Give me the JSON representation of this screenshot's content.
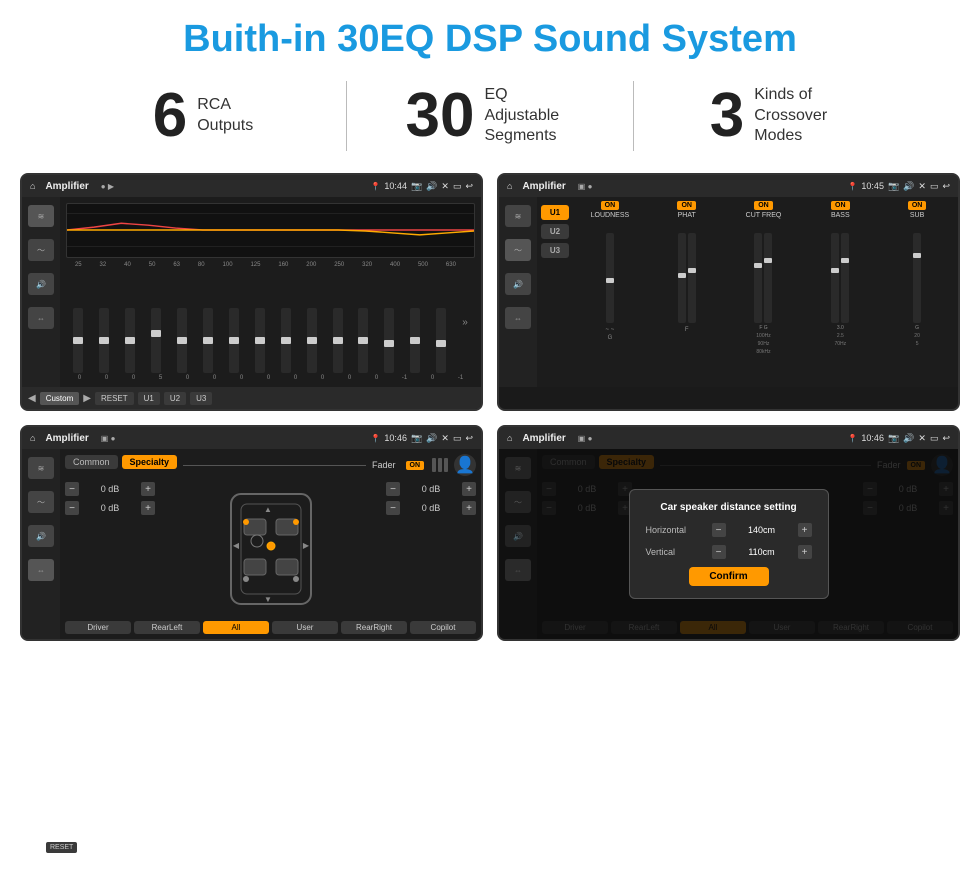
{
  "page": {
    "title": "Buith-in 30EQ DSP Sound System",
    "stats": [
      {
        "number": "6",
        "label": "RCA\nOutputs"
      },
      {
        "number": "30",
        "label": "EQ Adjustable\nSegments"
      },
      {
        "number": "3",
        "label": "Kinds of\nCrossover Modes"
      }
    ]
  },
  "screen1": {
    "status": {
      "title": "Amplifier",
      "time": "10:44"
    },
    "freqs": [
      "25",
      "32",
      "40",
      "50",
      "63",
      "80",
      "100",
      "125",
      "160",
      "200",
      "250",
      "320",
      "400",
      "500",
      "630"
    ],
    "values": [
      "0",
      "0",
      "0",
      "5",
      "0",
      "0",
      "0",
      "0",
      "0",
      "0",
      "0",
      "0",
      "-1",
      "0",
      "-1"
    ],
    "buttons": [
      "Custom",
      "RESET",
      "U1",
      "U2",
      "U3"
    ],
    "slider_positions": [
      50,
      50,
      50,
      38,
      50,
      50,
      50,
      50,
      50,
      50,
      50,
      50,
      54,
      50,
      54
    ]
  },
  "screen2": {
    "status": {
      "title": "Amplifier",
      "time": "10:45"
    },
    "presets": [
      "U1",
      "U2",
      "U3"
    ],
    "channels": [
      {
        "on": true,
        "label": "LOUDNESS"
      },
      {
        "on": true,
        "label": "PHAT"
      },
      {
        "on": true,
        "label": "CUT FREQ"
      },
      {
        "on": true,
        "label": "BASS"
      },
      {
        "on": true,
        "label": "SUB"
      }
    ],
    "reset_label": "RESET"
  },
  "screen3": {
    "status": {
      "title": "Amplifier",
      "time": "10:46"
    },
    "tabs": [
      "Common",
      "Specialty"
    ],
    "active_tab": "Specialty",
    "fader_label": "Fader",
    "fader_on": "ON",
    "controls_left": [
      "0 dB",
      "0 dB"
    ],
    "controls_right": [
      "0 dB",
      "0 dB"
    ],
    "bottom_buttons": [
      "Driver",
      "RearLeft",
      "All",
      "User",
      "RearRight",
      "Copilot"
    ]
  },
  "screen4": {
    "status": {
      "title": "Amplifier",
      "time": "10:46"
    },
    "tabs": [
      "Common",
      "Specialty"
    ],
    "active_tab": "Specialty",
    "dialog": {
      "title": "Car speaker distance setting",
      "horizontal_label": "Horizontal",
      "horizontal_value": "140cm",
      "vertical_label": "Vertical",
      "vertical_value": "110cm",
      "confirm_label": "Confirm"
    },
    "controls_right": [
      "0 dB",
      "0 dB"
    ],
    "bottom_buttons": [
      "Driver",
      "RearLeft",
      "All",
      "User",
      "RearRight",
      "Copilot"
    ]
  },
  "icons": {
    "home": "⌂",
    "settings": "⚙",
    "back": "↩",
    "location": "📍",
    "speaker": "🔊",
    "eq_icon": "≋",
    "wave_icon": "〜",
    "balance_icon": "⇔",
    "prev": "◀",
    "next": "▶",
    "expand": "»"
  }
}
